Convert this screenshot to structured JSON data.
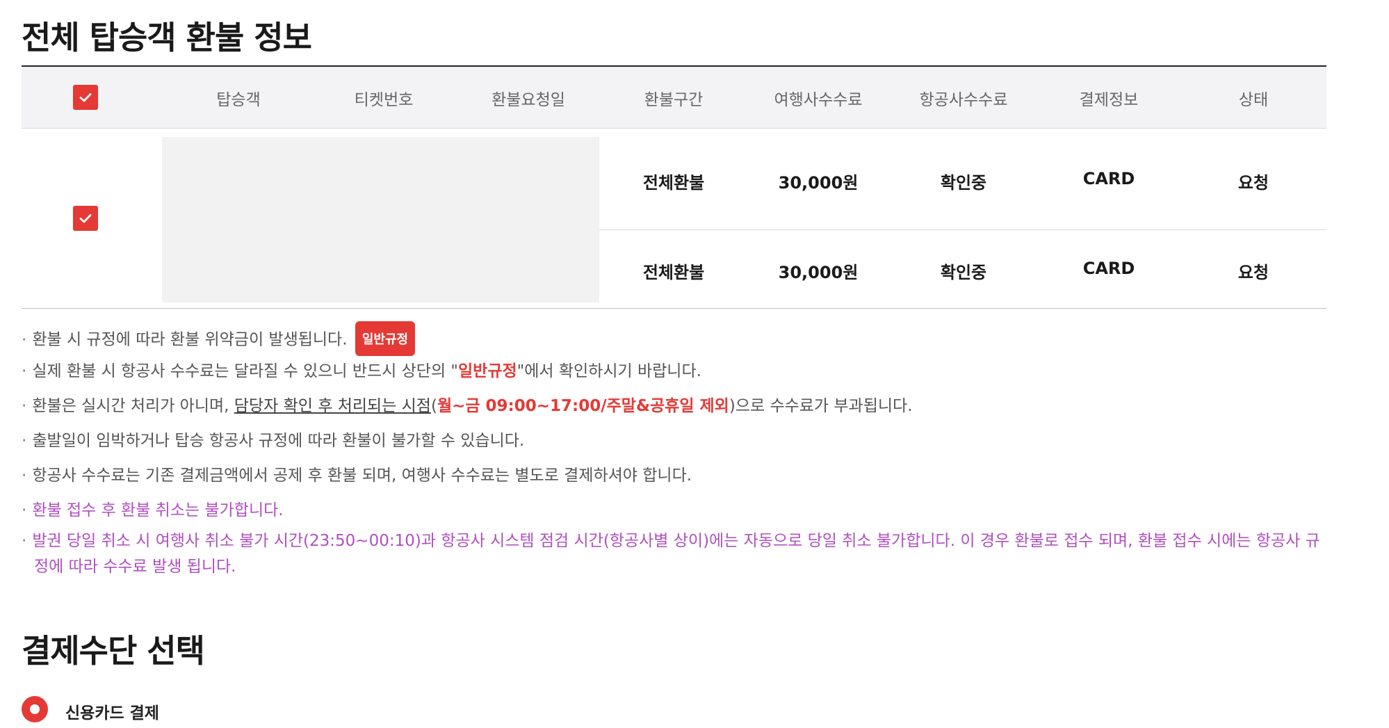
{
  "refund_section": {
    "title": "전체 탑승객 환불 정보",
    "columns": [
      "탑승객",
      "티켓번호",
      "환불요청일",
      "환불구간",
      "여행사수수료",
      "항공사수수료",
      "결제정보",
      "상태"
    ],
    "select_all_checked": true,
    "passenger_checked": true,
    "rows": [
      {
        "segment": "전체환불",
        "agency_fee": "30,000원",
        "airline_fee": "확인중",
        "payment": "CARD",
        "status": "요청"
      },
      {
        "segment": "전체환불",
        "agency_fee": "30,000원",
        "airline_fee": "확인중",
        "payment": "CARD",
        "status": "요청"
      }
    ]
  },
  "notes": {
    "n1_text": "환불 시 규정에 따라 환불 위약금이 발생됩니다.",
    "n1_badge": "일반규정",
    "n2_pre": "실제 환불 시 항공사 수수료는 달라질 수 있으니 반드시 상단의 \"",
    "n2_highlight": "일반규정",
    "n2_post": "\"에서 확인하시기 바랍니다.",
    "n3_pre": "환불은 실시간 처리가 아니며, ",
    "n3_underline": "담당자 확인 후 처리되는 시점",
    "n3_paren_open": "(",
    "n3_highlight": "월~금 09:00~17:00/주말&공휴일 제외",
    "n3_post": ")으로 수수료가 부과됩니다.",
    "n4": "출발일이 임박하거나 탑승 항공사 규정에 따라 환불이 불가할 수 있습니다.",
    "n5": "항공사 수수료는 기존 결제금액에서 공제 후 환불 되며, 여행사 수수료는 별도로 결제하셔야 합니다.",
    "n6": "환불 접수 후 환불 취소는 불가합니다.",
    "n7_line1": "발권 당일 취소 시 여행사 취소 불가 시간(23:50~00:10)과 항공사 시스템 점검 시간(항공사별 상이)에는 자동으로 당일 취소 불가합니다. 이 경우 환불로 접수 되며, 환불 접수 시에는 항공사 규",
    "n7_line2": "정에 따라 수수료 발생 됩니다."
  },
  "payment_section": {
    "title": "결제수단 선택",
    "options": [
      {
        "label": "신용카드 결제",
        "selected": true
      }
    ]
  },
  "colors": {
    "accent_red": "#e53935",
    "notice_purple": "#b04fc0",
    "header_bg": "#f3f3f5",
    "redacted_bg": "#f2f2f2"
  },
  "icons": {
    "checkbox": "check-icon",
    "radio": "radio-selected-icon"
  }
}
